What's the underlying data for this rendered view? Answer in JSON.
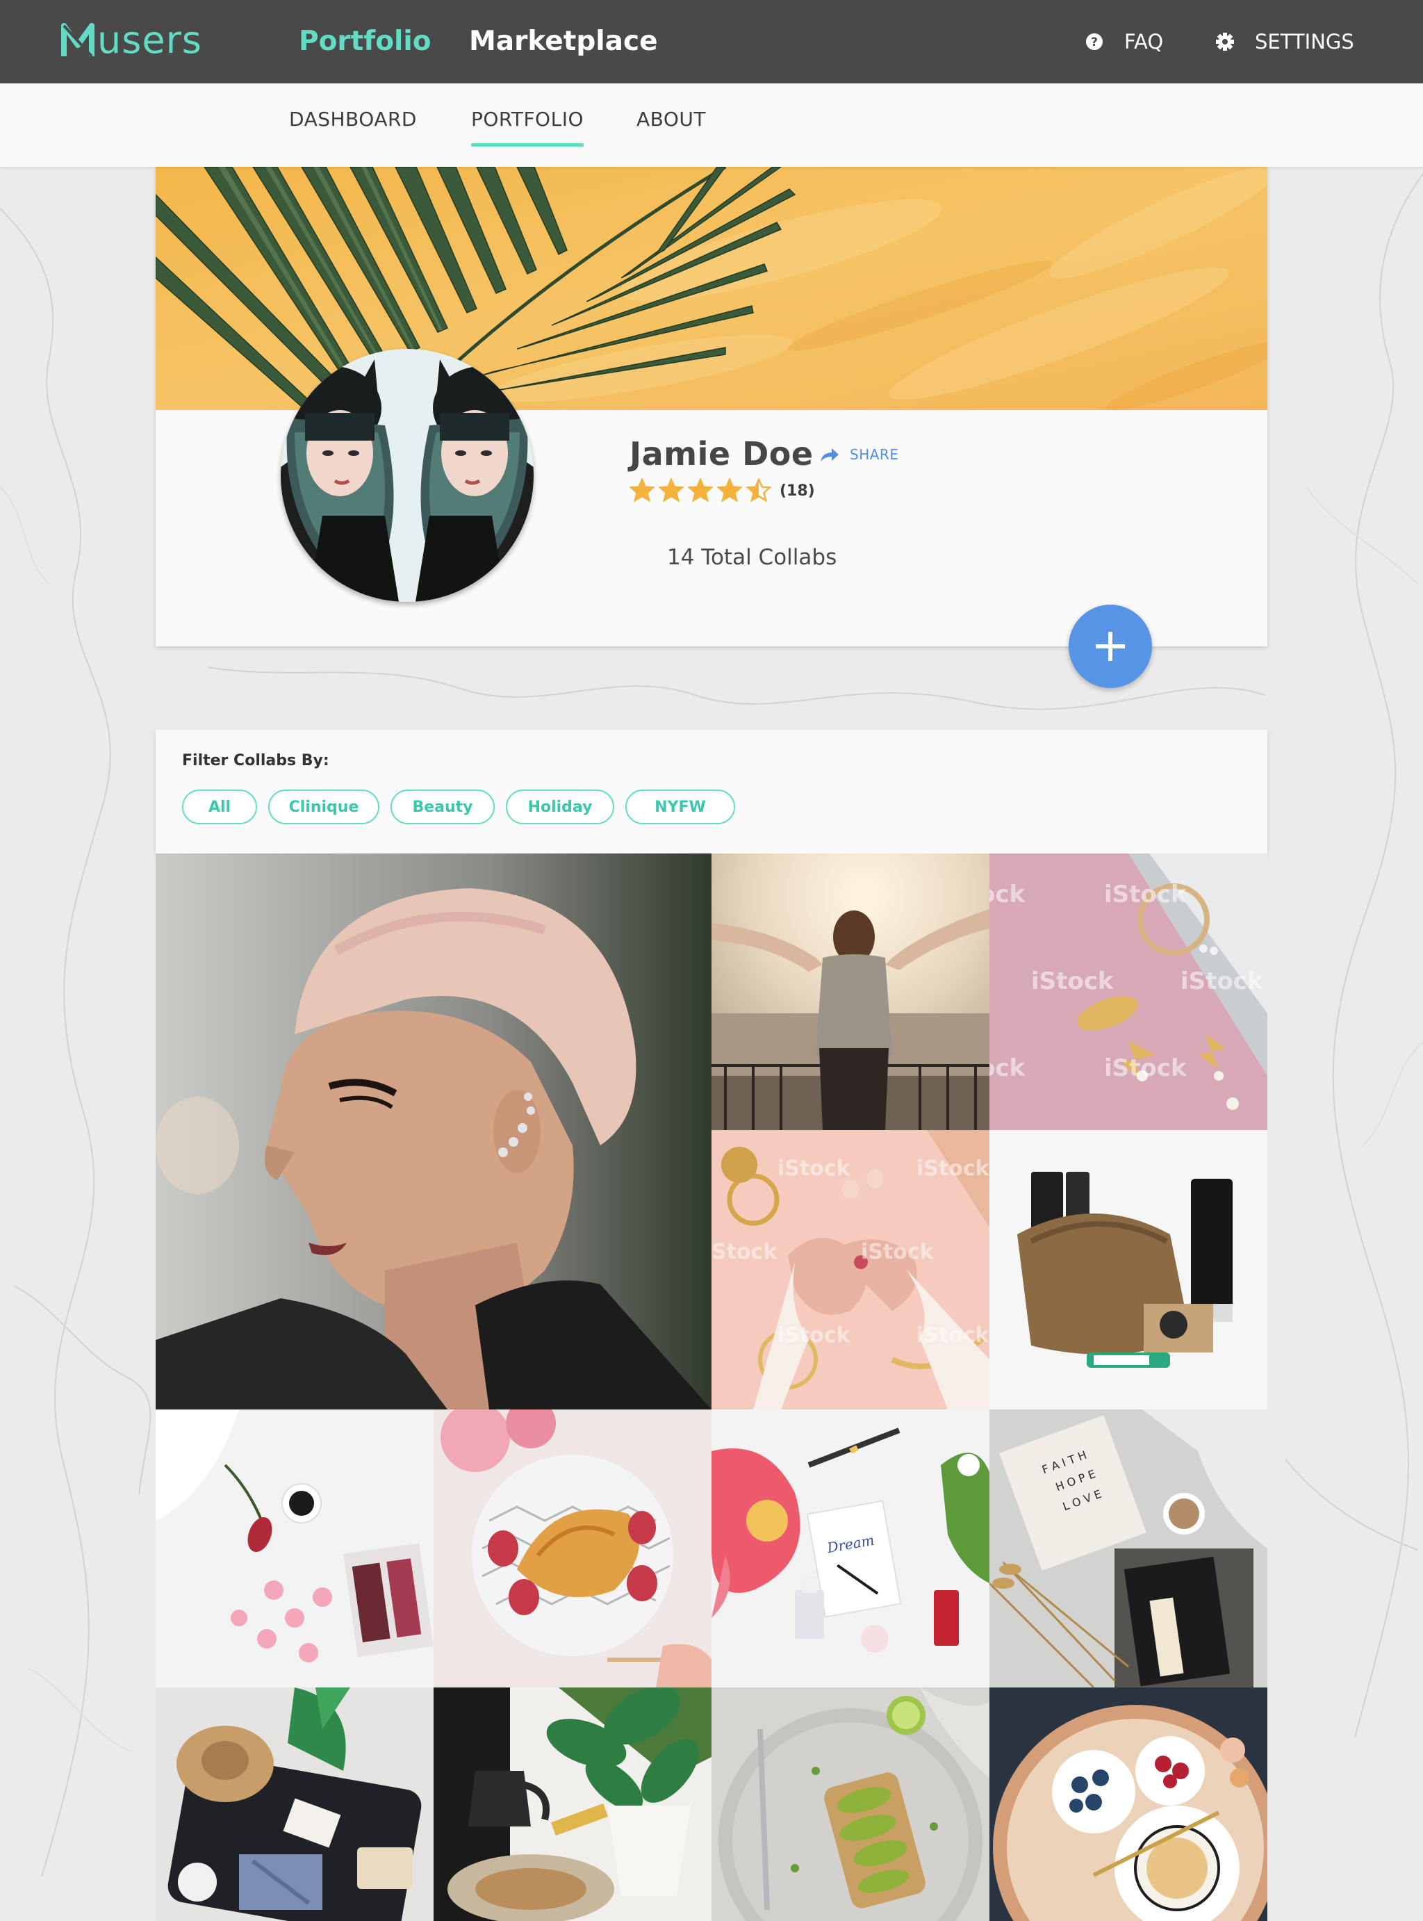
{
  "app": {
    "logo_text": "users",
    "brand_color": "#62dcc4",
    "accent_blue": "#5894e6"
  },
  "topnav": {
    "portfolio": "Portfolio",
    "marketplace": "Marketplace",
    "faq": "FAQ",
    "settings": "SETTINGS"
  },
  "subnav": {
    "items": [
      {
        "label": "DASHBOARD"
      },
      {
        "label": "PORTFOLIO",
        "active": true
      },
      {
        "label": "ABOUT"
      }
    ]
  },
  "profile": {
    "name": "Jamie Doe",
    "share_label": "SHARE",
    "rating": 4.5,
    "rating_max": 5,
    "rating_count": "(18)",
    "total_collabs": "14 Total Collabs"
  },
  "filter": {
    "title": "Filter Collabs By:",
    "chips": [
      "All",
      "Clinique",
      "Beauty",
      "Holiday",
      "NYFW"
    ]
  },
  "gallery": {
    "items": [
      {
        "subject": "portrait-pink-hair"
      },
      {
        "subject": "woman-balcony-sunrise"
      },
      {
        "subject": "gold-jewelry-pink"
      },
      {
        "subject": "hands-bracelets"
      },
      {
        "subject": "grooming-kit"
      },
      {
        "subject": "coffee-macarons-bed"
      },
      {
        "subject": "croissant-strawberries"
      },
      {
        "subject": "flowers-stationery"
      },
      {
        "subject": "faith-hope-love-card"
      },
      {
        "subject": "travel-suitcase"
      },
      {
        "subject": "coffee-plant"
      },
      {
        "subject": "avocado-toast"
      },
      {
        "subject": "breakfast-tray"
      }
    ]
  }
}
